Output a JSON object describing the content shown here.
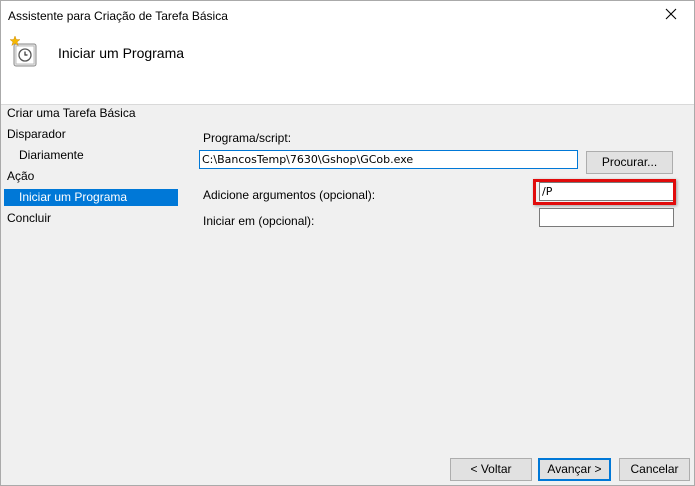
{
  "window": {
    "title": "Assistente para Criação de Tarefa Básica",
    "header_title": "Iniciar um Programa"
  },
  "nav": {
    "items": [
      {
        "label": "Criar uma Tarefa Básica",
        "selected": false
      },
      {
        "label": "Disparador",
        "selected": false
      },
      {
        "label": "Diariamente",
        "selected": false
      },
      {
        "label": "Ação",
        "selected": false
      },
      {
        "label": "Iniciar um Programa",
        "selected": true
      },
      {
        "label": "Concluir",
        "selected": false
      }
    ]
  },
  "form": {
    "program_label": "Programa/script:",
    "program_value": "C:\\BancosTemp\\7630\\Gshop\\GCob.exe",
    "browse_label": "Procurar...",
    "args_label": "Adicione argumentos (opcional):",
    "args_value": "/P",
    "startin_label": "Iniciar em (opcional):",
    "startin_value": ""
  },
  "footer": {
    "back_label": "< Voltar",
    "next_label": "Avançar >",
    "cancel_label": "Cancelar"
  },
  "colors": {
    "selection": "#0078d7",
    "highlight_box": "#e10b0b"
  },
  "icons": [
    "close-icon",
    "task-clock-icon"
  ]
}
